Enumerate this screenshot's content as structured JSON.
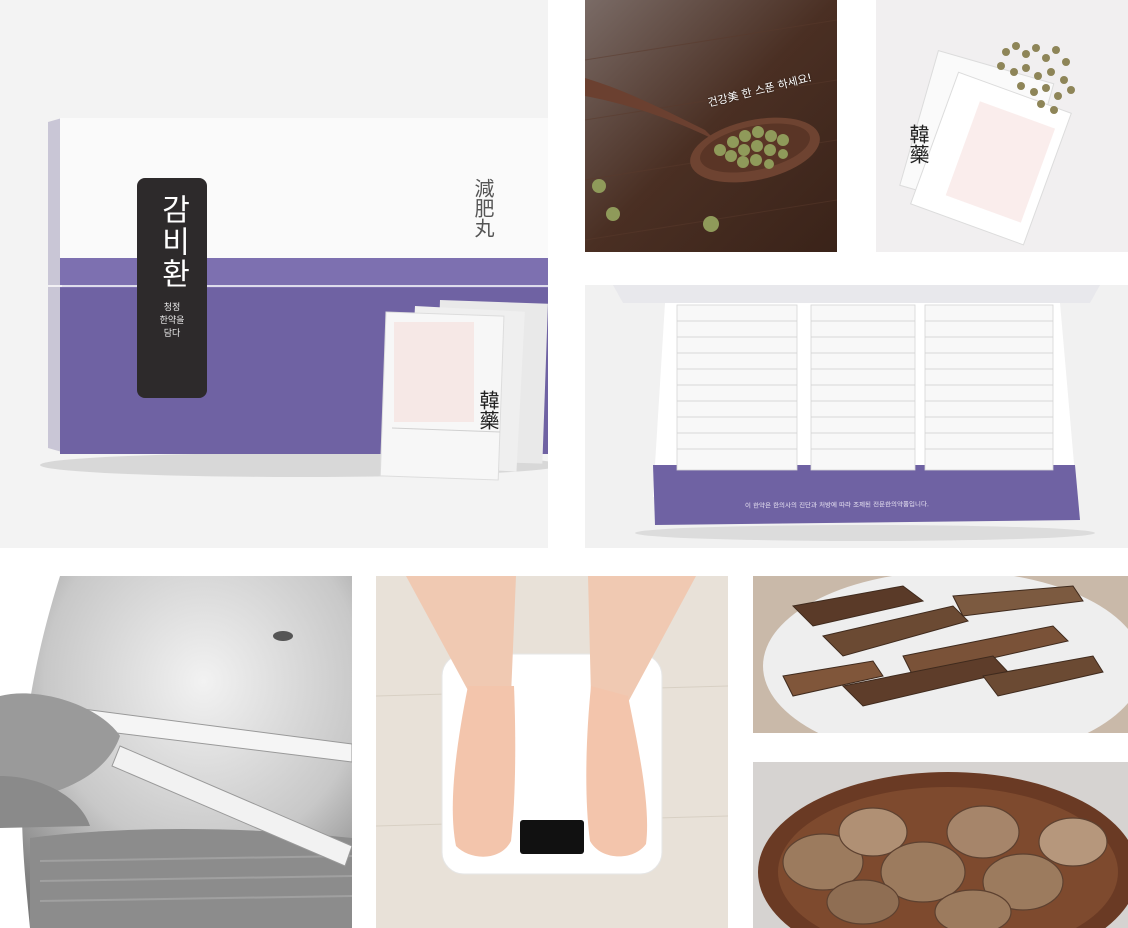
{
  "box": {
    "label_main": "감비환",
    "label_sub": "청정\n한약을\n담다",
    "hanja": "減肥丸",
    "sachet_mark": "韓藥"
  },
  "spoon": {
    "caption": "건강美 한 스푼 하세요!"
  },
  "sachet": {
    "mark": "韓藥"
  },
  "open_box": {
    "caption": "이 한약은 한의사의 진단과 처방에 따라 조제된 전문한의약품입니다."
  },
  "colors": {
    "brand_purple": "#6f62a3",
    "label_dark": "#2d2a2b",
    "wood": "#4a2f23"
  }
}
